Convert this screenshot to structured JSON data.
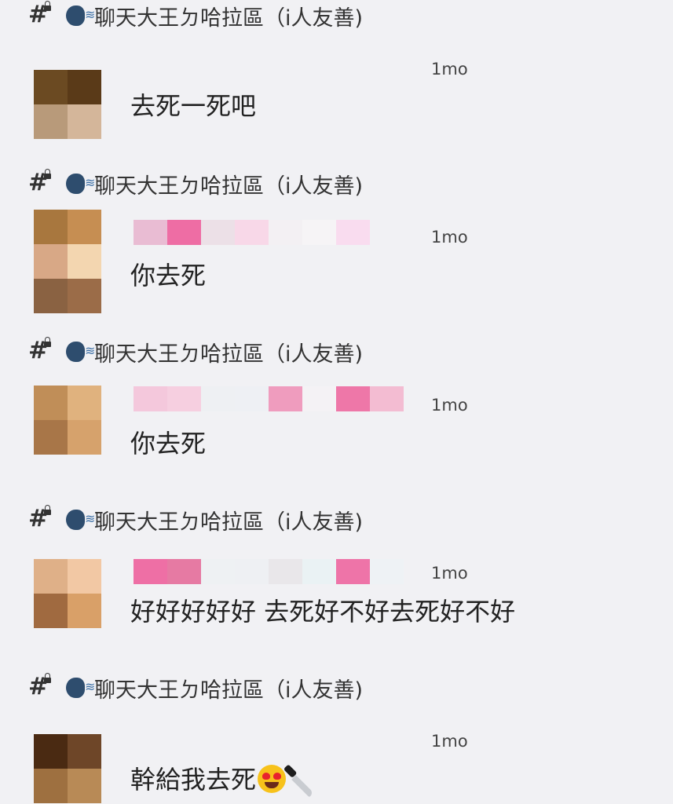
{
  "channel": {
    "name": "聊天大王ㄉ哈拉區（i人友善)",
    "icons": [
      "hashtag-lock-icon",
      "speaking-head-icon"
    ]
  },
  "messages": [
    {
      "time": "1mo",
      "text": "去死一死吧",
      "avatar_colors": [
        "#6b4a22",
        "#5a3a18",
        "#b89a7a",
        "#d4b69a"
      ],
      "name_colors": []
    },
    {
      "time": "1mo",
      "text": "你去死",
      "avatar_colors": [
        "#a8773e",
        "#c68e52",
        "#d8a886",
        "#f3d6b0",
        "#8a6242",
        "#9b6c48"
      ],
      "name_colors": [
        "#e9bcd3",
        "#ee6da4",
        "#ece0e7",
        "#f8d8e8",
        "#f3f0f3",
        "#f6f4f6",
        "#f9dcef"
      ]
    },
    {
      "time": "1mo",
      "text": "你去死",
      "avatar_colors": [
        "#c08e58",
        "#e0b27e",
        "#a87648",
        "#d6a26c"
      ],
      "name_colors": [
        "#f4c8dc",
        "#f6cfe0",
        "#eef0f3",
        "#eef0f4",
        "#ef9cbe",
        "#f4f2f5",
        "#ee77a8",
        "#f3bcd2"
      ]
    },
    {
      "time": "1mo",
      "text": "好好好好好 去死好不好去死好不好",
      "avatar_colors": [
        "#dfb088",
        "#f2c8a4",
        "#a06a40",
        "#d9a068"
      ],
      "name_colors": [
        "#ee6fa5",
        "#e67aa3",
        "#eef1f3",
        "#eef0f3",
        "#e9e7ea",
        "#eaf2f4",
        "#ee74a8",
        "#eef2f5"
      ]
    },
    {
      "time": "1mo",
      "text": "幹給我去死",
      "emojis": [
        "heart-eyes-emoji",
        "kitchen-knife-emoji"
      ],
      "avatar_colors": [
        "#4a2a12",
        "#6e4628",
        "#9e7040",
        "#b88a56"
      ],
      "name_colors": []
    }
  ]
}
